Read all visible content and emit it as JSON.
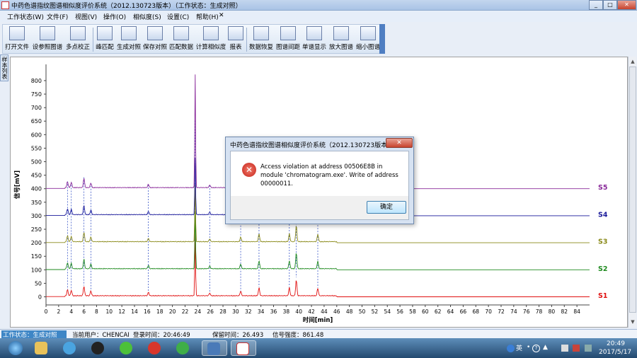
{
  "window": {
    "title": "中药色谱指纹图谱相似度评价系统（2012.130723版本）（工作状态：生成对照）",
    "controls": [
      "_",
      "□",
      "✕"
    ]
  },
  "menu": [
    "工作状态(W)",
    "文件(F)",
    "视图(V)",
    "操作(O)",
    "相似度(S)",
    "设置(C)",
    "帮助(H)",
    "✕"
  ],
  "toolbar": [
    {
      "label": "打开文件",
      "icon": "open-file-icon"
    },
    {
      "label": "设参照图谱",
      "icon": "reference-chart-icon"
    },
    {
      "label": "多点校正",
      "icon": "multipoint-correction-icon"
    },
    {
      "label": "峰匹配",
      "icon": "peak-match-icon"
    },
    {
      "label": "生成对照",
      "icon": "generate-reference-icon"
    },
    {
      "label": "保存对照",
      "icon": "save-reference-icon"
    },
    {
      "label": "匹配数据",
      "icon": "match-data-icon"
    },
    {
      "label": "计算相似度",
      "icon": "calculate-similarity-icon"
    },
    {
      "label": "报表",
      "icon": "report-icon"
    },
    {
      "label": "数据恢复",
      "icon": "data-restore-icon"
    },
    {
      "label": "图谱间距",
      "icon": "chart-spacing-icon"
    },
    {
      "label": "单谱显示",
      "icon": "single-spectrum-icon"
    },
    {
      "label": "放大图谱",
      "icon": "zoom-in-chart-icon"
    },
    {
      "label": "缩小图谱",
      "icon": "zoom-out-chart-icon"
    }
  ],
  "side_tab": "样本列表",
  "chart_data": {
    "type": "line",
    "xlabel": "时间[min]",
    "ylabel": "信号[mV]",
    "xlim": [
      0,
      86
    ],
    "ylim": [
      -30,
      860
    ],
    "xticks": [
      0,
      2,
      4,
      6,
      8,
      10,
      12,
      14,
      16,
      18,
      20,
      22,
      24,
      26,
      28,
      30,
      32,
      34,
      36,
      38,
      40,
      42,
      44,
      46,
      48,
      50,
      52,
      54,
      56,
      58,
      60,
      62,
      64,
      66,
      68,
      70,
      72,
      74,
      76,
      78,
      80,
      82,
      84
    ],
    "yticks": [
      0,
      50,
      100,
      150,
      200,
      250,
      300,
      350,
      400,
      450,
      500,
      550,
      600,
      650,
      700,
      750,
      800
    ],
    "series": [
      {
        "name": "S1",
        "color": "#e01010",
        "offset": 0
      },
      {
        "name": "S2",
        "color": "#1e8a1e",
        "offset": 100
      },
      {
        "name": "S3",
        "color": "#8a8a1a",
        "offset": 200
      },
      {
        "name": "S4",
        "color": "#1a1a9a",
        "offset": 300
      },
      {
        "name": "S5",
        "color": "#8a2a9a",
        "offset": 400
      }
    ],
    "peaks": [
      {
        "x": 3.4,
        "h": 45
      },
      {
        "x": 4.0,
        "h": 40
      },
      {
        "x": 6.0,
        "h": 70
      },
      {
        "x": 7.1,
        "h": 35
      },
      {
        "x": 16.2,
        "h": 25
      },
      {
        "x": 23.6,
        "h": 420
      },
      {
        "x": 25.9,
        "h": 20
      },
      {
        "x": 30.8,
        "h": 35
      },
      {
        "x": 33.7,
        "h": 60
      },
      {
        "x": 38.5,
        "h": 60
      },
      {
        "x": 39.6,
        "h": 120
      },
      {
        "x": 43.0,
        "h": 55
      }
    ],
    "grid": false
  },
  "dialog": {
    "title": "中药色谱指纹图谱相似度评价系统（2012.130723版本）",
    "close": "✕",
    "message": "Access violation at address 00506E8B in module 'chromatogram.exe'. Write of address 00000011.",
    "ok_label": "确定"
  },
  "status": {
    "work_state": "工作状态：生成对照",
    "user": "当前用户：CHENCAI",
    "login_time": "登录时间：20:46:49",
    "retention_time": "保留时间：26.493",
    "signal": "信号强度：861.48"
  },
  "taskbar": {
    "time": "20:49",
    "date": "2017/5/17",
    "ime": "英",
    "apps": [
      "start-button-icon",
      "file-explorer-icon",
      "browser-icon",
      "qq-icon",
      "wechat-icon",
      "netease-music-icon",
      "refresh-app-icon",
      "remote-desktop-icon",
      "chromatogram-app-icon"
    ]
  }
}
